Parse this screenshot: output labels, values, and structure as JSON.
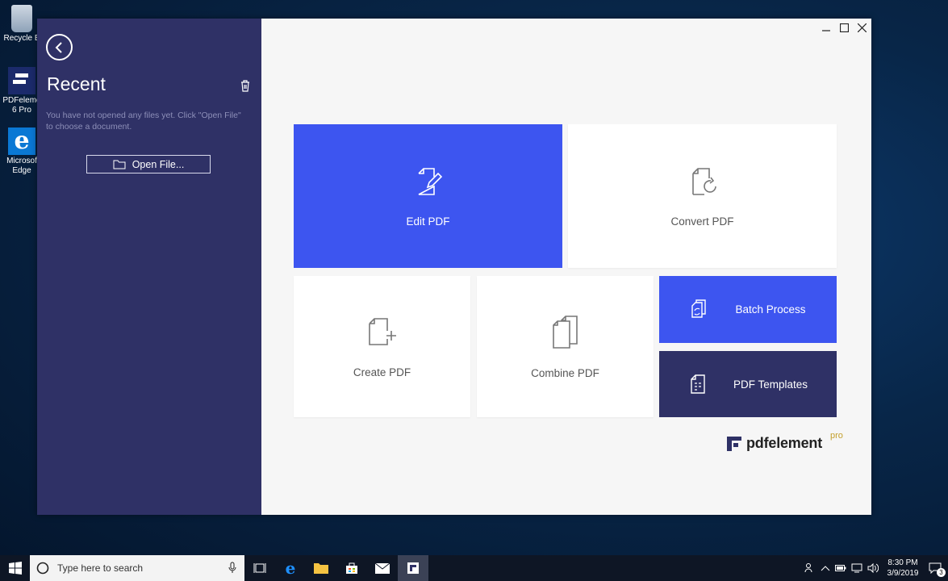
{
  "desktop": {
    "icons": [
      {
        "label": "Recycle B"
      },
      {
        "label": "PDFeleme\n6 Pro"
      },
      {
        "label": "Microsof\nEdge"
      }
    ]
  },
  "sidebar": {
    "title": "Recent",
    "empty_message": "You have not opened any files yet. Click \"Open File\" to choose a document.",
    "open_file_label": "Open File..."
  },
  "tiles": {
    "edit": "Edit PDF",
    "convert": "Convert PDF",
    "create": "Create PDF",
    "combine": "Combine PDF",
    "batch": "Batch Process",
    "templates": "PDF Templates"
  },
  "brand": {
    "name": "pdfelement",
    "edition": "pro"
  },
  "colors": {
    "sidebar": "#2f3166",
    "accent_blue": "#3d55f0",
    "navy": "#2f3166"
  },
  "taskbar": {
    "search_placeholder": "Type here to search",
    "time": "8:30 PM",
    "date": "3/9/2019",
    "notification_count": "3"
  }
}
